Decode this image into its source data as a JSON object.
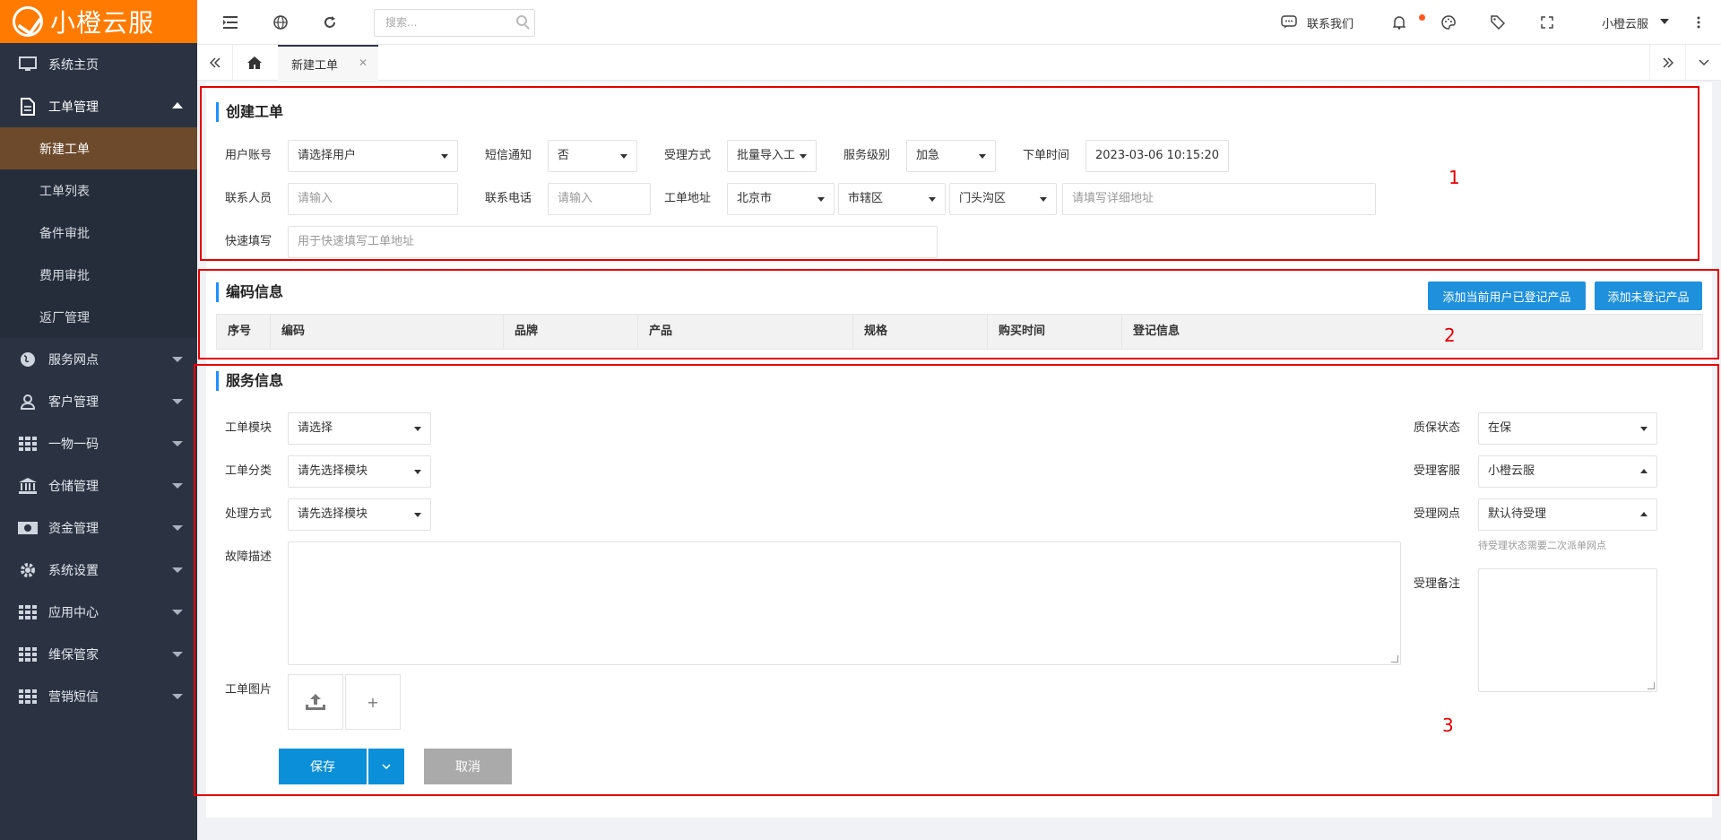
{
  "app": {
    "brand": "小橙云服"
  },
  "sidebar": {
    "items": [
      {
        "label": "系统主页",
        "icon": "monitor-icon"
      },
      {
        "label": "工单管理",
        "icon": "document-icon",
        "expanded": true,
        "children": [
          "新建工单",
          "工单列表",
          "备件审批",
          "费用审批",
          "返厂管理"
        ]
      },
      {
        "label": "服务网点",
        "icon": "globe-icon"
      },
      {
        "label": "客户管理",
        "icon": "user-icon"
      },
      {
        "label": "一物一码",
        "icon": "grid-icon"
      },
      {
        "label": "仓储管理",
        "icon": "bank-icon"
      },
      {
        "label": "资金管理",
        "icon": "money-icon"
      },
      {
        "label": "系统设置",
        "icon": "gear-icon"
      },
      {
        "label": "应用中心",
        "icon": "grid-icon"
      },
      {
        "label": "维保管家",
        "icon": "grid-icon"
      },
      {
        "label": "营销短信",
        "icon": "grid-icon"
      }
    ],
    "active_child": "新建工单"
  },
  "topbar": {
    "search_placeholder": "搜索...",
    "contact": "联系我们",
    "user": "小橙云服"
  },
  "tabs": {
    "active": "新建工单"
  },
  "create": {
    "title": "创建工单",
    "user_account_label": "用户账号",
    "user_account_value": "请选择用户",
    "sms_label": "短信通知",
    "sms_value": "否",
    "accept_method_label": "受理方式",
    "accept_method_value": "批量导入工",
    "service_level_label": "服务级别",
    "service_level_value": "加急",
    "order_time_label": "下单时间",
    "order_time_value": "2023-03-06 10:15:20",
    "contact_label": "联系人员",
    "contact_placeholder": "请输入",
    "phone_label": "联系电话",
    "phone_placeholder": "请输入",
    "address_label": "工单地址",
    "province": "北京市",
    "city": "市辖区",
    "district": "门头沟区",
    "address_placeholder": "请填写详细地址",
    "quick_label": "快速填写",
    "quick_placeholder": "用于快速填写工单地址"
  },
  "codes": {
    "title": "编码信息",
    "add_registered": "添加当前用户已登记产品",
    "add_unregistered": "添加未登记产品",
    "columns": [
      "序号",
      "编码",
      "品牌",
      "产品",
      "规格",
      "购买时间",
      "登记信息"
    ]
  },
  "service": {
    "title": "服务信息",
    "module_label": "工单模块",
    "module_value": "请选择",
    "category_label": "工单分类",
    "category_value": "请先选择模块",
    "handling_label": "处理方式",
    "handling_value": "请先选择模块",
    "fault_label": "故障描述",
    "image_label": "工单图片",
    "warranty_label": "质保状态",
    "warranty_value": "在保",
    "agent_label": "受理客服",
    "agent_value": "小橙云服",
    "outlet_label": "受理网点",
    "outlet_value": "默认待受理",
    "outlet_hint": "待受理状态需要二次派单网点",
    "remark_label": "受理备注",
    "save": "保存",
    "cancel": "取消",
    "add_symbol": "+"
  },
  "annotations": [
    "1",
    "2",
    "3"
  ]
}
